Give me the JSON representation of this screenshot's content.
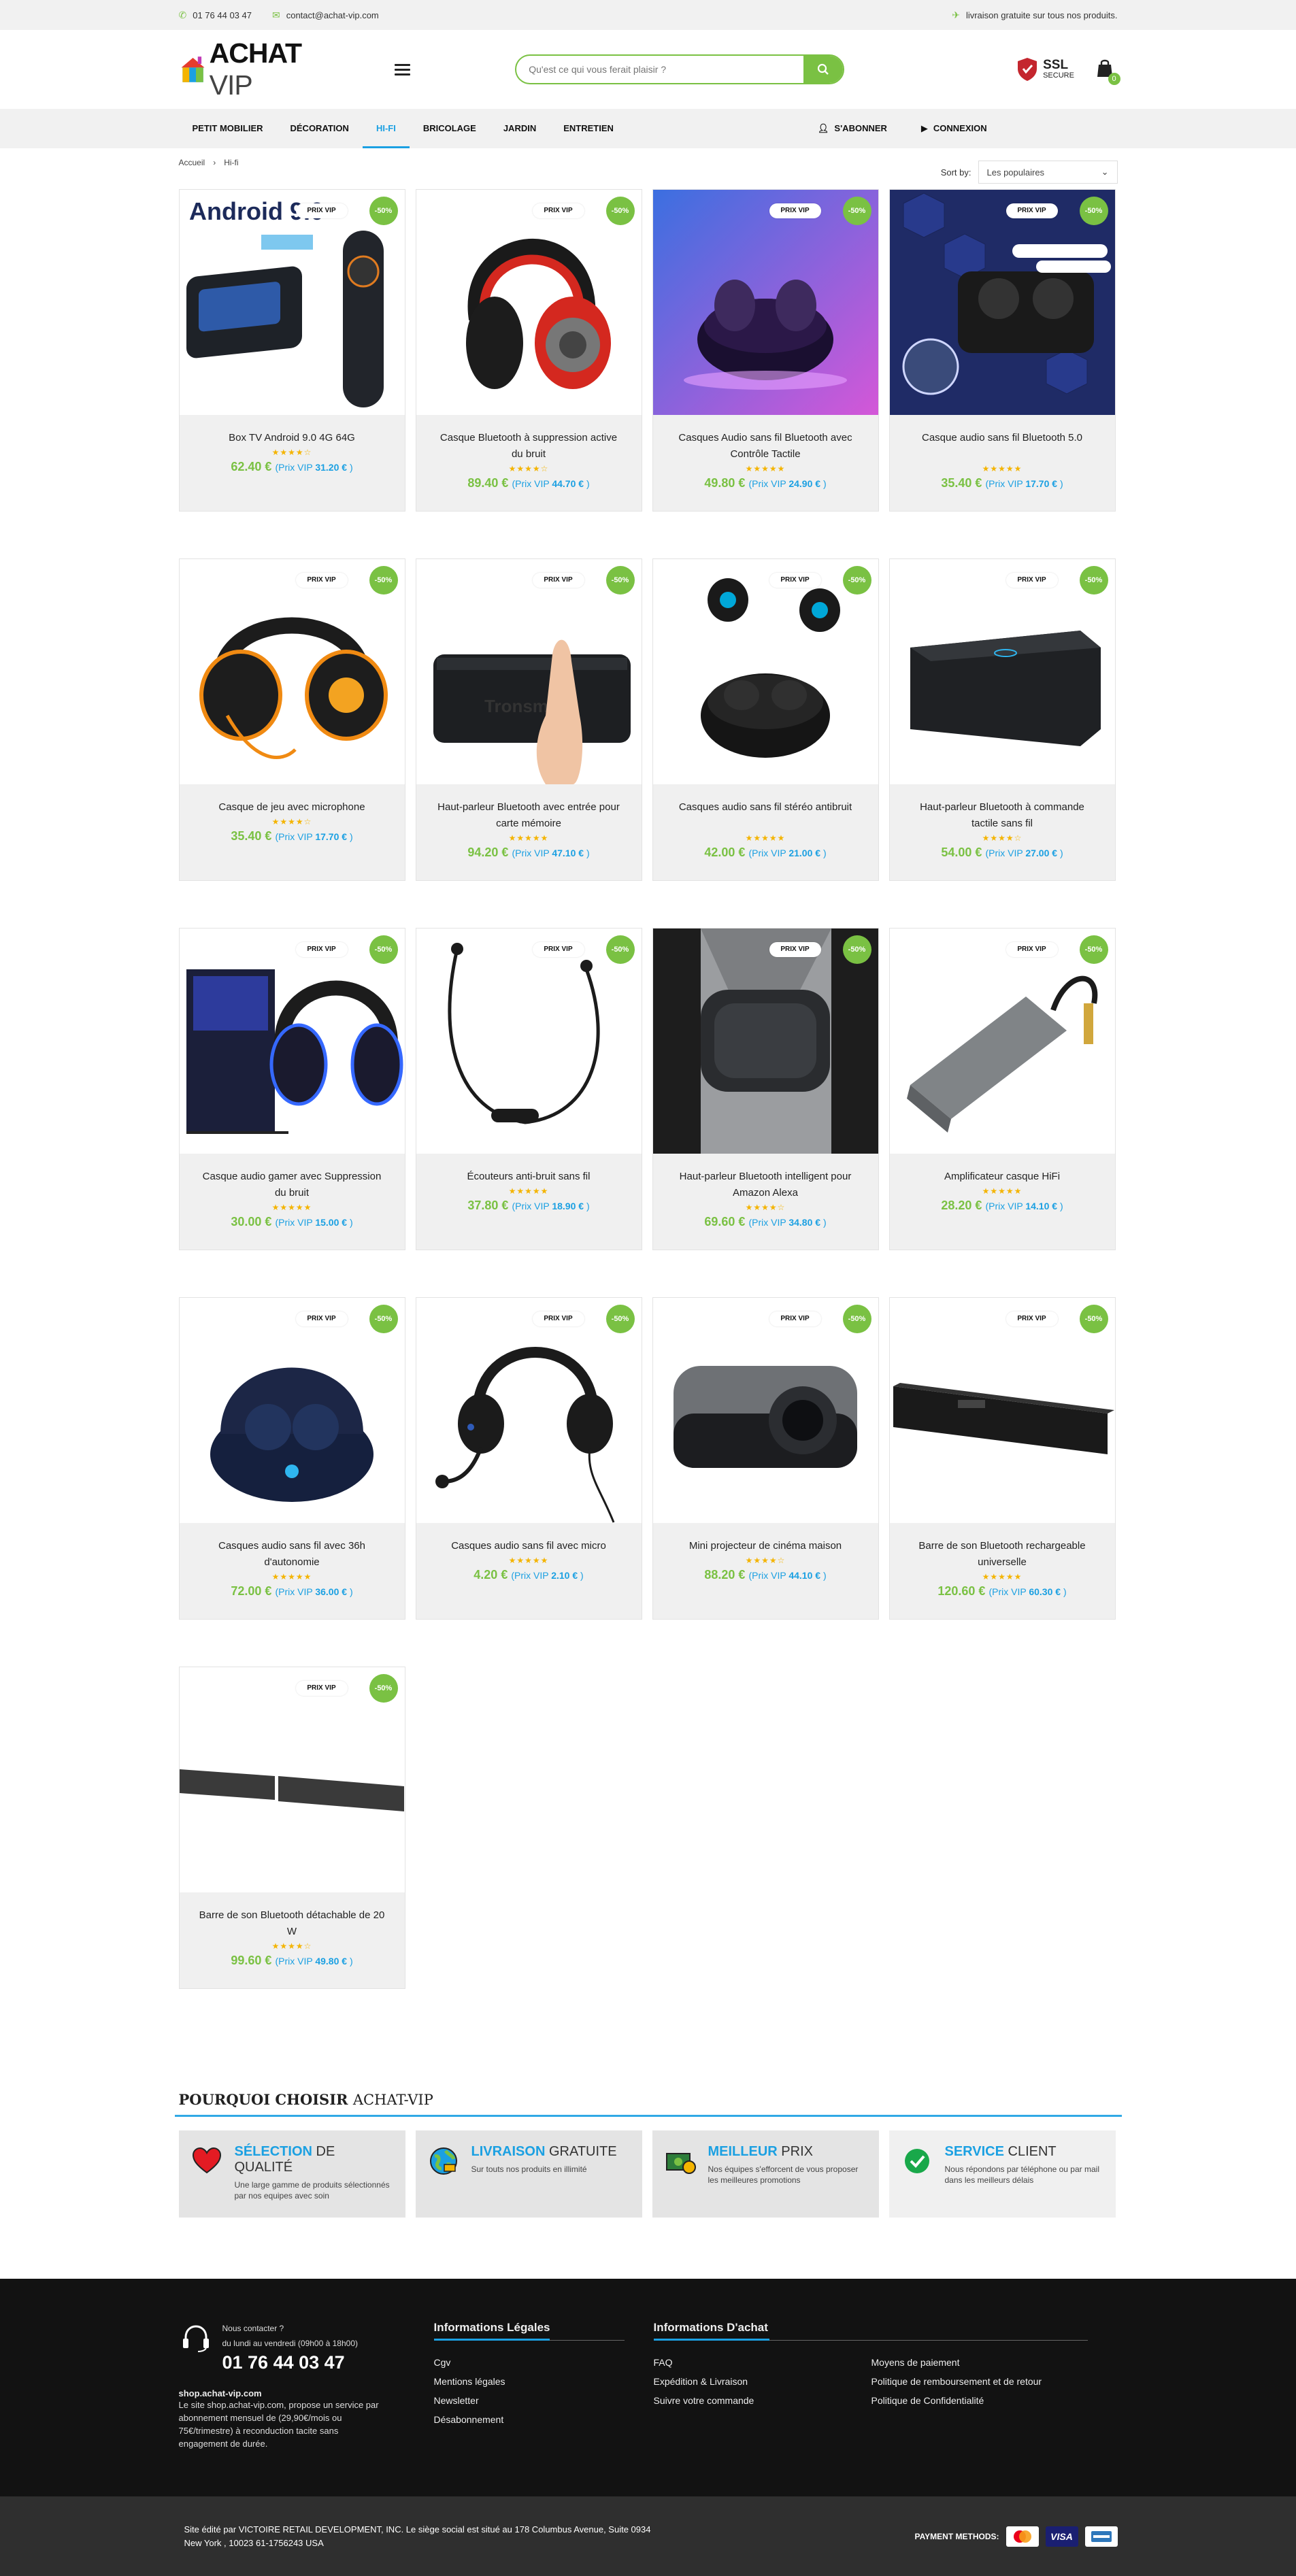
{
  "topbar": {
    "phone": "01 76 44 03 47",
    "email": "contact@achat-vip.com",
    "shipping": "livraison gratuite sur tous nos produits."
  },
  "header": {
    "logo_main": "ACHAT",
    "logo_sub": "VIP",
    "search_placeholder": "Qu'est ce qui vous ferait plaisir ?",
    "ssl_title": "SSL",
    "ssl_sub": "SECURE",
    "cart_count": "0"
  },
  "nav": {
    "items": [
      "PETIT MOBILIER",
      "DÉCORATION",
      "HI-FI",
      "BRICOLAGE",
      "JARDIN",
      "ENTRETIEN"
    ],
    "active": "HI-FI",
    "subscribe": "S'ABONNER",
    "login": "CONNEXION"
  },
  "breadcrumb": {
    "home": "Accueil",
    "current": "Hi-fi",
    "sep": "›"
  },
  "sort": {
    "label": "Sort by:",
    "value": "Les populaires"
  },
  "badges": {
    "vip": "PRIX VIP",
    "discount": "-50%"
  },
  "products": [
    {
      "name": "Box TV Android 9.0 4G 64G",
      "price": "62.40 €",
      "vip": "31.20 €",
      "stars": "★★★★☆",
      "img": "android-tv-box"
    },
    {
      "name": "Casque Bluetooth à suppression active du bruit",
      "price": "89.40 €",
      "vip": "44.70 €",
      "stars": "★★★★☆",
      "img": "red-headphones"
    },
    {
      "name": "Casques Audio sans fil Bluetooth avec Contrôle Tactile",
      "price": "49.80 €",
      "vip": "24.90 €",
      "stars": "★★★★★",
      "img": "earbuds-purple"
    },
    {
      "name": "Casque audio sans fil Bluetooth 5.0",
      "price": "35.40 €",
      "vip": "17.70 €",
      "stars": "★★★★★",
      "img": "earbuds-case-blue"
    },
    {
      "name": "Casque de jeu avec microphone",
      "price": "35.40 €",
      "vip": "17.70 €",
      "stars": "★★★★☆",
      "img": "gaming-headset-orange"
    },
    {
      "name": "Haut-parleur Bluetooth avec entrée pour carte mémoire",
      "price": "94.20 €",
      "vip": "47.10 €",
      "stars": "★★★★★",
      "img": "speaker-tronsmart"
    },
    {
      "name": "Casques audio sans fil stéréo antibruit",
      "price": "42.00 €",
      "vip": "21.00 €",
      "stars": "★★★★★",
      "img": "earbuds-black"
    },
    {
      "name": "Haut-parleur Bluetooth à commande tactile sans fil",
      "price": "54.00 €",
      "vip": "27.00 €",
      "stars": "★★★★☆",
      "img": "speaker-black"
    },
    {
      "name": "Casque audio gamer avec Suppression du bruit",
      "price": "30.00 €",
      "vip": "15.00 €",
      "stars": "★★★★★",
      "img": "gaming-headset-blue"
    },
    {
      "name": "Écouteurs anti-bruit sans fil",
      "price": "37.80 €",
      "vip": "18.90 €",
      "stars": "★★★★★",
      "img": "neckband-earphones"
    },
    {
      "name": "Haut-parleur Bluetooth intelligent pour Amazon Alexa",
      "price": "69.60 €",
      "vip": "34.80 €",
      "stars": "★★★★☆",
      "img": "pocket-speaker"
    },
    {
      "name": "Amplificateur casque HiFi",
      "price": "28.20 €",
      "vip": "14.10 €",
      "stars": "★★★★★",
      "img": "hifi-amplifier"
    },
    {
      "name": "Casques audio sans fil avec 36h d'autonomie",
      "price": "72.00 €",
      "vip": "36.00 €",
      "stars": "★★★★★",
      "img": "sport-earbuds"
    },
    {
      "name": "Casques audio sans fil avec micro",
      "price": "4.20 €",
      "vip": "2.10 €",
      "stars": "★★★★★",
      "img": "headset-mic"
    },
    {
      "name": "Mini projecteur de cinéma maison",
      "price": "88.20 €",
      "vip": "44.10 €",
      "stars": "★★★★☆",
      "img": "mini-projector"
    },
    {
      "name": "Barre de son Bluetooth rechargeable universelle",
      "price": "120.60 €",
      "vip": "60.30 €",
      "stars": "★★★★★",
      "img": "soundbar"
    },
    {
      "name": "Barre de son Bluetooth détachable de 20 W",
      "price": "99.60 €",
      "vip": "49.80 €",
      "stars": "★★★★☆",
      "img": "split-soundbar"
    }
  ],
  "vip_prefix": "(Prix VIP",
  "vip_suffix": ")",
  "why": {
    "title_bold": "POURQUOI CHOISIR",
    "title_rest": "ACHAT-VIP",
    "boxes": [
      {
        "t1": "SÉLECTION",
        "t2": "DE QUALITÉ",
        "d": "Une large gamme de produits sélectionnés par nos equipes avec soin",
        "icon": "heart-icon"
      },
      {
        "t1": "LIVRAISON",
        "t2": "GRATUITE",
        "d": "Sur touts nos produits en illimité",
        "icon": "globe-icon"
      },
      {
        "t1": "MEILLEUR",
        "t2": "PRIX",
        "d": "Nos équipes s'efforcent de vous proposer les meilleures promotions",
        "icon": "money-icon"
      },
      {
        "t1": "SERVICE",
        "t2": "CLIENT",
        "d": "Nous répondons par téléphone ou par mail dans les meilleurs délais",
        "icon": "check-icon"
      }
    ]
  },
  "footer": {
    "contact_q": "Nous contacter ?",
    "hours": "du lundi au vendredi (09h00 à 18h00)",
    "phone": "01 76 44 03 47",
    "site": "shop.achat-vip.com",
    "desc": "Le site shop.achat-vip.com, propose un service par abonnement mensuel de (29,90€/mois ou 75€/trimestre) à reconduction tacite sans engagement de durée.",
    "legal_title": "Informations Légales",
    "legal_links": [
      "Cgv",
      "Mentions légales",
      "Newsletter",
      "Désabonnement"
    ],
    "buy_title": "Informations D'achat",
    "buy_links": [
      "FAQ",
      "Moyens de paiement",
      "Expédition & Livraison",
      "Politique de remboursement et de retour",
      "Suivre votre commande",
      "Politique de Confidentialité"
    ],
    "copy": "Site édité par VICTOIRE RETAIL DEVELOPMENT, INC. Le siège social est situé au 178 Columbus Avenue, Suite 0934 New York , 10023 61-1756243 USA",
    "pay_label": "PAYMENT METHODS:",
    "pay_cards": [
      "mastercard-icon",
      "visa-icon",
      "amex-icon"
    ],
    "visa_text": "VISA"
  }
}
